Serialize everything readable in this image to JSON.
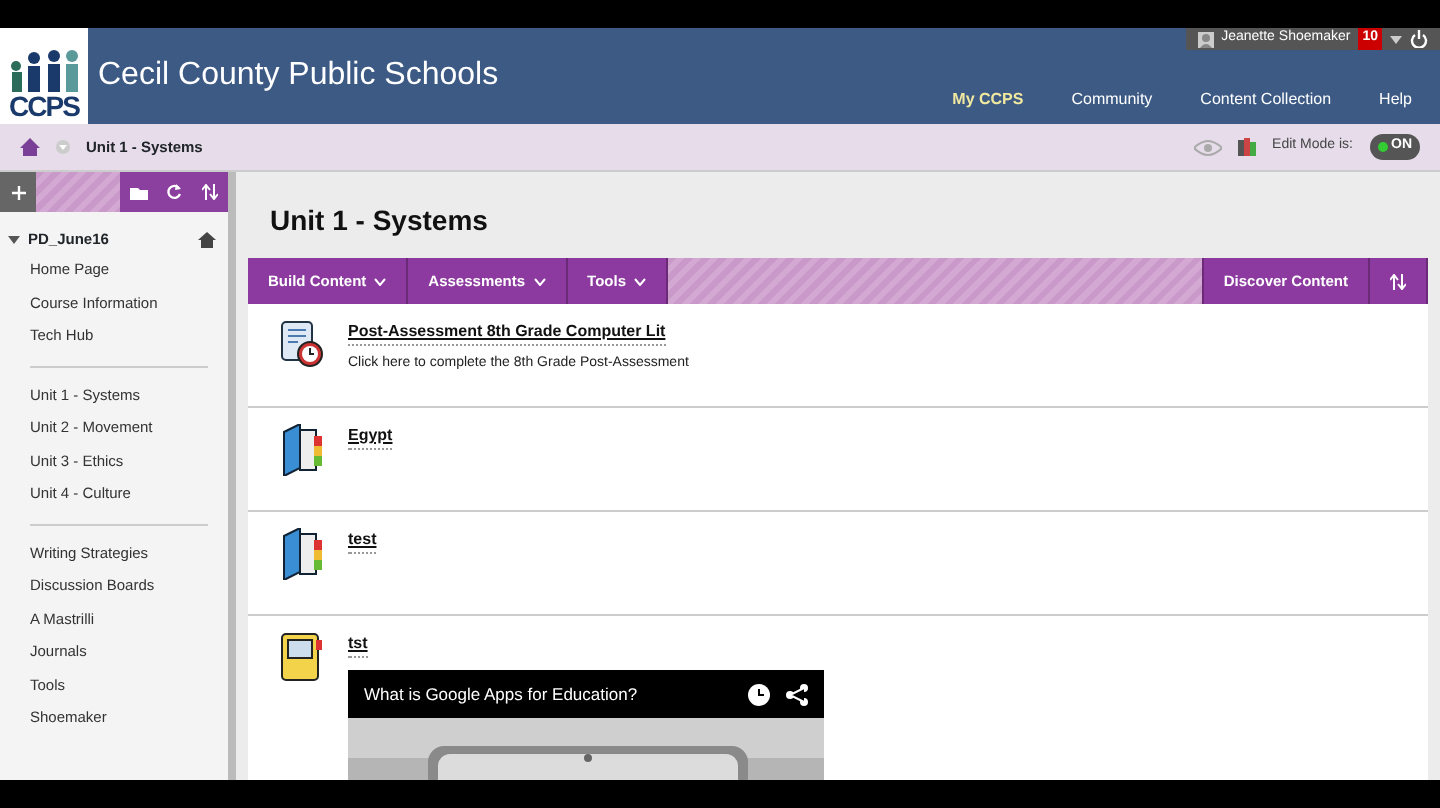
{
  "user": {
    "name": "Jeanette Shoemaker",
    "notifications": "10"
  },
  "site": {
    "logo": "CCPS",
    "title": "Cecil County Public Schools"
  },
  "tabs": [
    {
      "label": "My CCPS",
      "selected": true
    },
    {
      "label": "Community",
      "selected": false
    },
    {
      "label": "Content Collection",
      "selected": false
    },
    {
      "label": "Help",
      "selected": false
    }
  ],
  "breadcrumb": "Unit 1 - Systems",
  "edit_mode": {
    "label": "Edit Mode is:",
    "value": "ON",
    "on": true
  },
  "course": {
    "title": "PD_June16",
    "groups": [
      [
        "Home Page",
        "Course Information",
        "Tech Hub"
      ],
      [
        "Unit 1 - Systems",
        "Unit 2 - Movement",
        "Unit 3 - Ethics",
        "Unit 4 - Culture"
      ],
      [
        "Writing Strategies",
        "Discussion Boards",
        "A Mastrilli",
        "Journals",
        "Tools",
        "Shoemaker"
      ]
    ]
  },
  "page_title": "Unit 1 - Systems",
  "action_bar": {
    "menus": [
      "Build Content",
      "Assessments",
      "Tools"
    ],
    "right": "Discover Content"
  },
  "items": [
    {
      "kind": "test",
      "title": "Post-Assessment 8th Grade Computer Lit",
      "description": "Click here to complete the 8th Grade Post-Assessment"
    },
    {
      "kind": "folder",
      "title": "Egypt"
    },
    {
      "kind": "folder",
      "title": "test"
    },
    {
      "kind": "item",
      "title": "tst",
      "video": {
        "title": "What is Google Apps for Education?"
      }
    }
  ]
}
